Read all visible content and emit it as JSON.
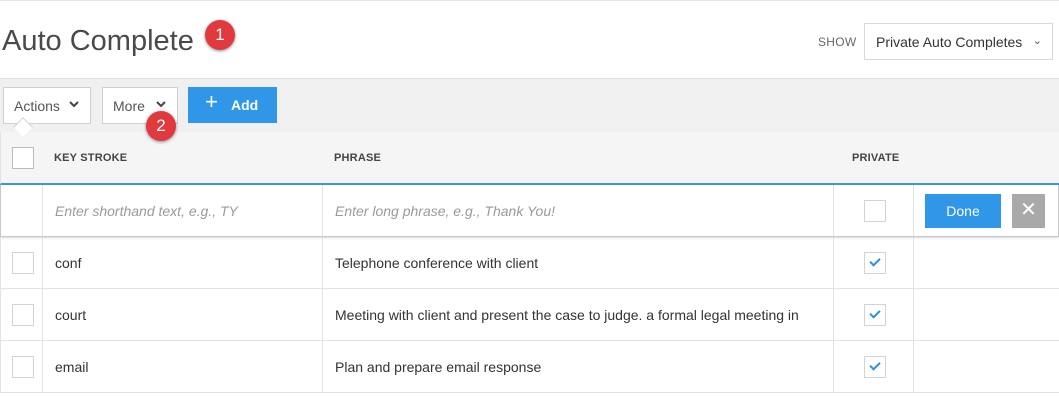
{
  "page": {
    "title": "Auto Complete",
    "badge_1": "1",
    "badge_2": "2",
    "show_label": "SHOW",
    "show_value": "Private Auto Completes"
  },
  "toolbar": {
    "actions_label": "Actions",
    "more_label": "More",
    "add_label": "Add"
  },
  "table": {
    "headers": {
      "keystroke": "KEY STROKE",
      "phrase": "PHRASE",
      "private": "PRIVATE"
    },
    "new_row": {
      "keystroke_placeholder": "Enter shorthand text, e.g., TY",
      "phrase_placeholder": "Enter long phrase, e.g., Thank You!",
      "done_label": "Done",
      "private_checked": false
    },
    "rows": [
      {
        "keystroke": "conf",
        "phrase": "Telephone conference with client",
        "private": true
      },
      {
        "keystroke": "court",
        "phrase": "Meeting with client and present the case to judge. a formal legal meeting in",
        "private": true
      },
      {
        "keystroke": "email",
        "phrase": "Plan and prepare email response",
        "private": true
      }
    ]
  },
  "colors": {
    "accent": "#2f96e8",
    "badge": "#e0393e",
    "cancel": "#a9a9a9"
  },
  "icons": [
    "chevron-down-icon",
    "plus-icon",
    "check-icon",
    "close-icon"
  ]
}
